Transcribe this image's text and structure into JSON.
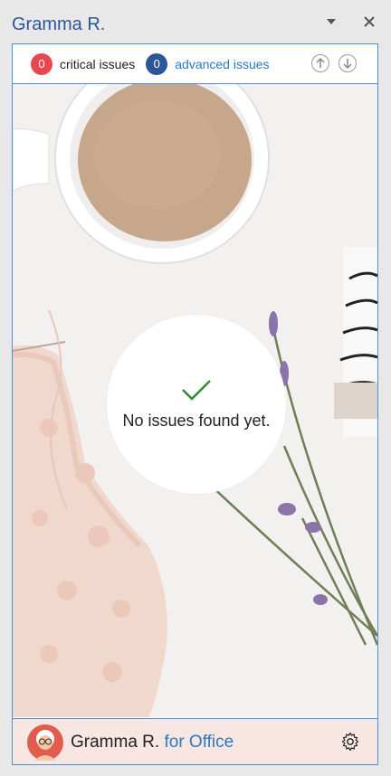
{
  "window": {
    "title": "Gramma R."
  },
  "issues": {
    "critical": {
      "count": "0",
      "label": "critical issues",
      "color": "#e8474f"
    },
    "advanced": {
      "count": "0",
      "label": "advanced issues",
      "color": "#2b5797"
    }
  },
  "status": {
    "message": "No issues found yet."
  },
  "footer": {
    "name": "Gramma R.",
    "suffix": "for Office"
  },
  "icons": [
    "dropdown-icon",
    "close-icon",
    "arrow-up-icon",
    "arrow-down-icon",
    "checkmark-icon",
    "avatar",
    "gear-icon"
  ],
  "colors": {
    "accent": "#2b579a",
    "border": "#4a90d9",
    "check": "#2e8b2e",
    "footer_bg": "#f7e6e2"
  }
}
